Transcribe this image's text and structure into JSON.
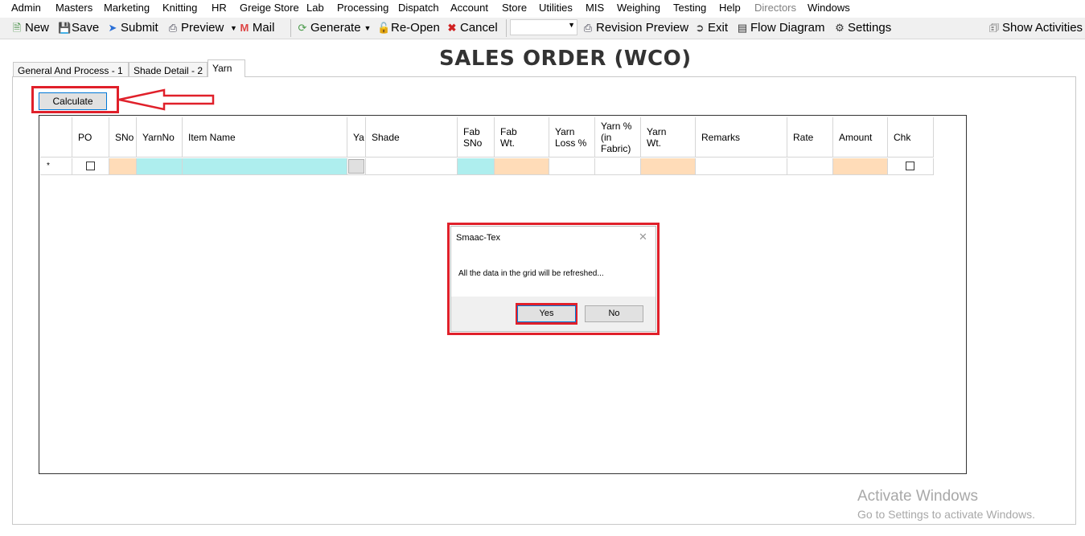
{
  "menu": [
    "Admin",
    "Masters",
    "Marketing",
    "Knitting",
    "HR",
    "Greige Store",
    "Lab",
    "Processing",
    "Dispatch",
    "Account",
    "Store",
    "Utilities",
    "MIS",
    "Weighing",
    "Testing",
    "Help",
    "Directors",
    "Windows"
  ],
  "toolbar": {
    "new": "New",
    "save": "Save",
    "submit": "Submit",
    "preview": "Preview",
    "mail": "Mail",
    "generate": "Generate",
    "reopen": "Re-Open",
    "cancel": "Cancel",
    "revision_preview": "Revision Preview",
    "exit": "Exit",
    "flow_diagram": "Flow Diagram",
    "settings": "Settings",
    "show_activities": "Show Activities"
  },
  "page_title": "SALES ORDER (WCO)",
  "tabs": [
    "General And Process - 1",
    "Shade Detail - 2",
    "Yarn"
  ],
  "calculate_label": "Calculate",
  "grid": {
    "headers": [
      "PO",
      "SNo",
      "YarnNo",
      "Item Name",
      "Ya",
      "Shade",
      "Fab SNo",
      "Fab Wt.",
      "Yarn Loss %",
      "Yarn % (in Fabric)",
      "Yarn Wt.",
      "Remarks",
      "Rate",
      "Amount",
      "Chk"
    ],
    "new_row_marker": "*"
  },
  "dialog": {
    "title": "Smaac-Tex",
    "message": "All the data in the grid will be refreshed...",
    "yes": "Yes",
    "no": "No"
  },
  "watermark": {
    "line1": "Activate Windows",
    "line2": "Go to Settings to activate Windows."
  },
  "colors": {
    "highlight_red": "#e0202a",
    "cell_peach": "#ffdcb8",
    "cell_cyan": "#aeeeee",
    "cell_gray": "#e0e0e0"
  }
}
